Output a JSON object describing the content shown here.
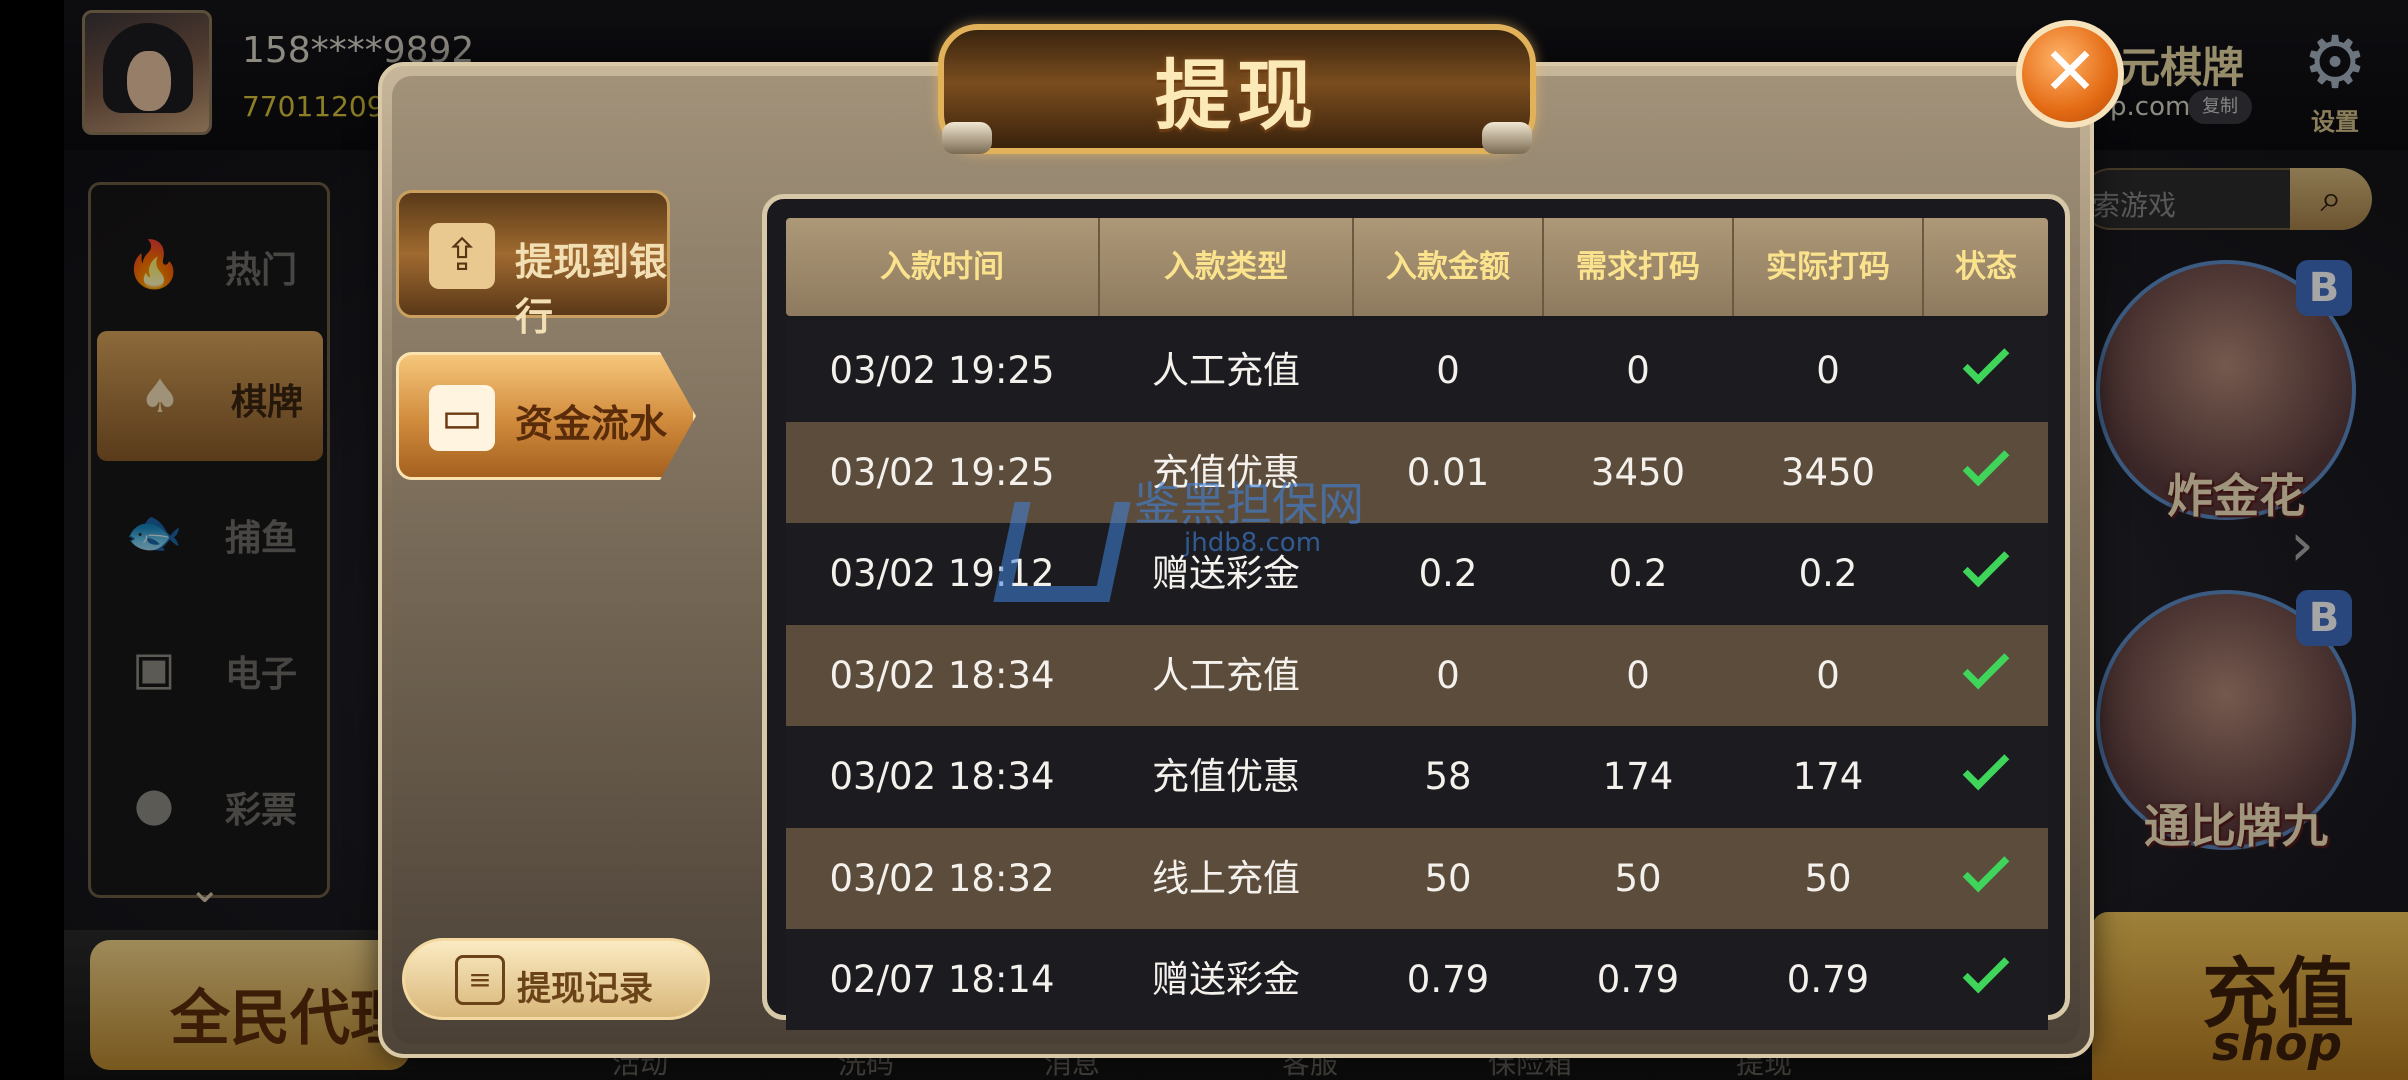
{
  "header": {
    "user_phone": "158****9892",
    "user_id": "77011209",
    "brand_title": "元棋牌",
    "brand_url": "p.com",
    "copy_label": "复制",
    "settings_label": "设置",
    "search_placeholder": "索游戏"
  },
  "sidebar": {
    "items": [
      {
        "label": "热门",
        "icon": "hot-flame-icon"
      },
      {
        "label": "棋牌",
        "icon": "playing-cards-icon"
      },
      {
        "label": "捕鱼",
        "icon": "fish-icon"
      },
      {
        "label": "电子",
        "icon": "slot-machine-icon"
      },
      {
        "label": "彩票",
        "icon": "lottery-ball-icon"
      }
    ]
  },
  "games": [
    {
      "name": "炸金花",
      "badge": "B"
    },
    {
      "name": "通比牌九",
      "badge": "B"
    }
  ],
  "bottom": {
    "agent_label": "全民代理",
    "recharge_label": "充值",
    "recharge_sub": "shop",
    "tabs": [
      "活动",
      "洗码",
      "消息",
      "客服",
      "保险箱",
      "提现"
    ]
  },
  "dialog": {
    "title": "提现",
    "close_symbol": "✕",
    "tabs": [
      {
        "label": "提现到银行",
        "icon": "bank-transfer-icon"
      },
      {
        "label": "资金流水",
        "icon": "wallet-icon"
      }
    ],
    "record_label": "提现记录",
    "watermark_text": "鉴黑担保网",
    "watermark_url": "jhdb8.com"
  },
  "table": {
    "columns": [
      "入款时间",
      "入款类型",
      "入款金额",
      "需求打码",
      "实际打码",
      "状态"
    ],
    "rows": [
      {
        "time": "03/02 19:25",
        "type": "人工充值",
        "amount": "0",
        "required": "0",
        "actual": "0",
        "status": "done"
      },
      {
        "time": "03/02 19:25",
        "type": "充值优惠",
        "amount": "0.01",
        "required": "3450",
        "actual": "3450",
        "status": "done"
      },
      {
        "time": "03/02 19:12",
        "type": "赠送彩金",
        "amount": "0.2",
        "required": "0.2",
        "actual": "0.2",
        "status": "done"
      },
      {
        "time": "03/02 18:34",
        "type": "人工充值",
        "amount": "0",
        "required": "0",
        "actual": "0",
        "status": "done"
      },
      {
        "time": "03/02 18:34",
        "type": "充值优惠",
        "amount": "58",
        "required": "174",
        "actual": "174",
        "status": "done"
      },
      {
        "time": "03/02 18:32",
        "type": "线上充值",
        "amount": "50",
        "required": "50",
        "actual": "50",
        "status": "done"
      },
      {
        "time": "02/07 18:14",
        "type": "赠送彩金",
        "amount": "0.79",
        "required": "0.79",
        "actual": "0.79",
        "status": "done"
      }
    ]
  },
  "colors": {
    "accent_gold": "#fbe38d",
    "check_green": "#3fd45a",
    "close_orange": "#e46b14"
  }
}
